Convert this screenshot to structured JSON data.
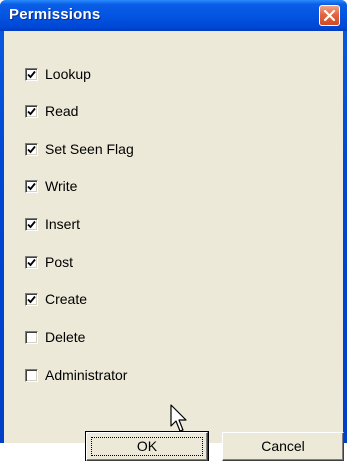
{
  "window": {
    "title": "Permissions",
    "close_icon": "close-icon"
  },
  "permissions": [
    {
      "label": "Lookup",
      "checked": true
    },
    {
      "label": "Read",
      "checked": true
    },
    {
      "label": "Set Seen Flag",
      "checked": true
    },
    {
      "label": "Write",
      "checked": true
    },
    {
      "label": "Insert",
      "checked": true
    },
    {
      "label": "Post",
      "checked": true
    },
    {
      "label": "Create",
      "checked": true
    },
    {
      "label": "Delete",
      "checked": false
    },
    {
      "label": "Administrator",
      "checked": false
    }
  ],
  "buttons": {
    "ok_label": "OK",
    "cancel_label": "Cancel"
  },
  "colors": {
    "titlebar": "#0454e2",
    "client": "#ece9d8",
    "close": "#e2663f"
  }
}
